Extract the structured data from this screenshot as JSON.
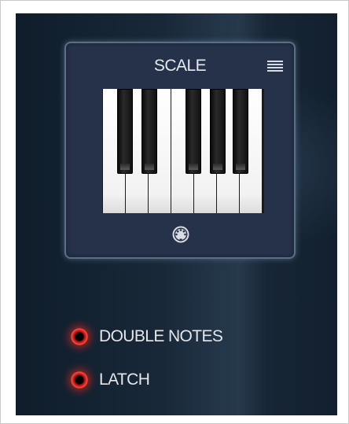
{
  "scale_panel": {
    "title": "SCALE",
    "menu_icon": "hamburger-menu-icon",
    "keyboard": {
      "white_keys": [
        "C",
        "D",
        "E",
        "F",
        "G",
        "A",
        "B"
      ],
      "black_keys": [
        "C#",
        "D#",
        "F#",
        "G#",
        "A#"
      ]
    },
    "footer_icon": "midi-connector-icon"
  },
  "options": [
    {
      "label": "DOUBLE NOTES",
      "state": "on",
      "led_color": "#e0261d"
    },
    {
      "label": "LATCH",
      "state": "on",
      "led_color": "#e0261d"
    }
  ]
}
